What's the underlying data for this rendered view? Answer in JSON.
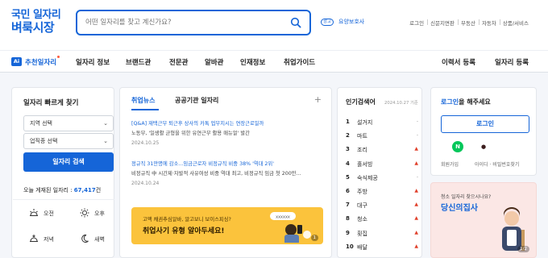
{
  "brand": {
    "line1": "국민 일자리",
    "line2": "벼룩시장"
  },
  "search": {
    "placeholder": "어떤 일자리를 찾고 계신가요?"
  },
  "ad": {
    "badge": "광고",
    "text": "요양보호사"
  },
  "top_links": [
    "로그인",
    "신문지면판",
    "부동산",
    "자동차",
    "상품/서비스"
  ],
  "nav": {
    "ai_badge": "Ai",
    "items": [
      "추천일자리",
      "일자리 정보",
      "브랜드관",
      "전문관",
      "알바관",
      "인재정보",
      "취업가이드"
    ],
    "right": [
      "이력서 등록",
      "일자리 등록"
    ]
  },
  "quick_search": {
    "title": "일자리 빠르게 찾기",
    "region_select": "지역 선택",
    "job_select": "업직종 선택",
    "button": "일자리 검색",
    "today_label": "오늘 게재된 일자리 : ",
    "today_count": "67,417",
    "today_unit": "건",
    "times": [
      {
        "label": "오전",
        "icon": "sunrise-icon"
      },
      {
        "label": "오후",
        "icon": "sun-icon"
      },
      {
        "label": "저녁",
        "icon": "sunset-icon"
      },
      {
        "label": "새벽",
        "icon": "moon-icon"
      }
    ]
  },
  "news": {
    "tabs": [
      "취업뉴스",
      "공공기관 일자리"
    ],
    "plus": "+",
    "items": [
      {
        "headline": "[Q&A] 재택근무 퇴근후 상사의 카톡 업무지시는 연장근로일까",
        "body": "노동부, '일생활 균형을 위한 유연근무 활용 매뉴얼' 발간",
        "date": "2024.10.25"
      },
      {
        "headline_pre": "정규직 31만명에 감소...임금근로자 비정규직 비중 38% '역대 2위'",
        "body": "비정규직 中 시간제·자발적 사유여성 비중 역대 최고, 비정규직 임금 첫 200만...",
        "date": "2024.10.24"
      }
    ],
    "banner": {
      "sub": "고액 채권추심알바, 알고보니 보이스피싱?",
      "main": "취업사기 유형 알아두세요!",
      "page": "1"
    }
  },
  "popular": {
    "title": "인기검색어",
    "date": "2024.10.27 기준",
    "items": [
      {
        "rank": "1",
        "keyword": "설거지",
        "trend": "-"
      },
      {
        "rank": "2",
        "keyword": "마트",
        "trend": "-"
      },
      {
        "rank": "3",
        "keyword": "조리",
        "trend": "▲"
      },
      {
        "rank": "4",
        "keyword": "홀서빙",
        "trend": "▲"
      },
      {
        "rank": "5",
        "keyword": "숙식제공",
        "trend": "-"
      },
      {
        "rank": "6",
        "keyword": "주방",
        "trend": "▲"
      },
      {
        "rank": "7",
        "keyword": "대구",
        "trend": "▲"
      },
      {
        "rank": "8",
        "keyword": "청소",
        "trend": "▲"
      },
      {
        "rank": "9",
        "keyword": "횟집",
        "trend": "▲"
      },
      {
        "rank": "10",
        "keyword": "배달",
        "trend": "▲"
      }
    ],
    "colors": {
      "up": "#e0402b",
      "same": "#999999"
    }
  },
  "login": {
    "prompt_highlight": "로그인",
    "prompt_rest": "을 해주세요",
    "button": "로그인",
    "social": [
      {
        "name": "naver",
        "glyph": "N",
        "bg": "#03c75a",
        "fg": "#ffffff"
      },
      {
        "name": "kakao",
        "glyph": "●",
        "bg": "#fee500",
        "fg": "#3c1e1e"
      },
      {
        "name": "apple",
        "glyph": "",
        "bg": "#ffffff",
        "fg": "#111111"
      }
    ],
    "links": [
      "회원가입",
      "아이디 · 비밀번호찾기"
    ]
  },
  "promo": {
    "sub": "청소 일자리 찾으시나요?",
    "main": "당신의집사",
    "page": "1/2"
  },
  "colors": {
    "accent": "#1565d8",
    "banner_bg": "#fbc33c",
    "promo_bg": "#fbe7e5"
  }
}
